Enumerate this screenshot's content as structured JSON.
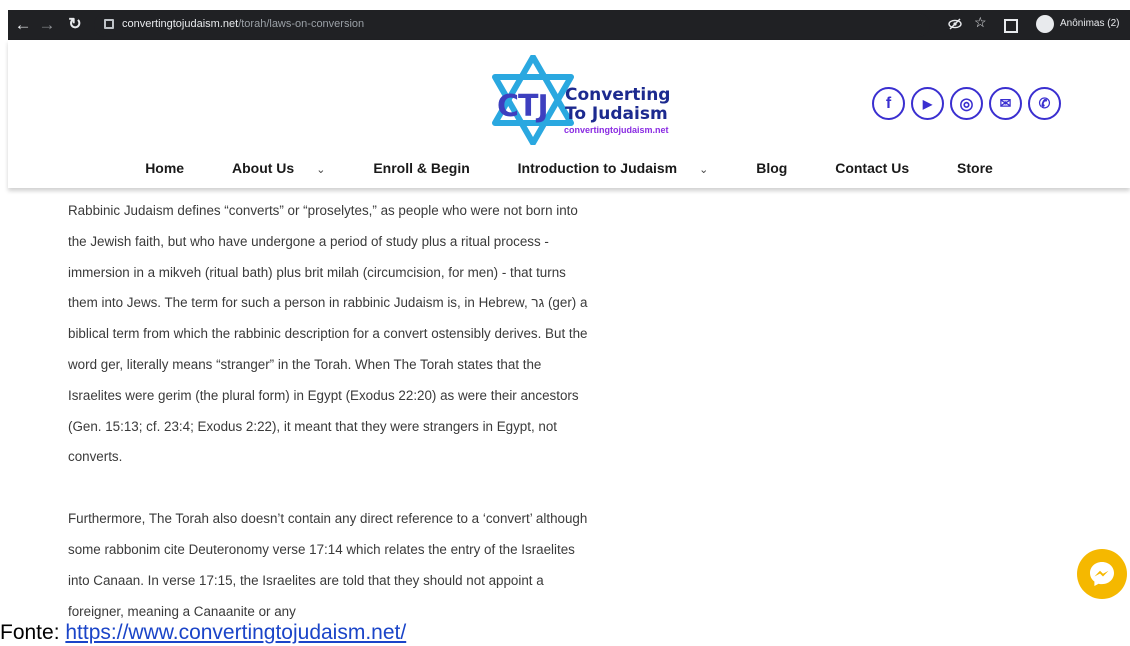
{
  "browser": {
    "url_domain": "convertingtojudaism.net",
    "url_path": "/torah/laws-on-conversion",
    "profile_label": "Anônimas (2)"
  },
  "site": {
    "logo": {
      "mark": "CTJ",
      "line1": "Converting",
      "line2": "To Judaism",
      "subtitle": "convertingtojudaism.net"
    },
    "socials": [
      {
        "icon": "facebook-icon",
        "glyph": "f"
      },
      {
        "icon": "youtube-icon",
        "glyph": "▶"
      },
      {
        "icon": "instagram-icon",
        "glyph": "◎"
      },
      {
        "icon": "email-icon",
        "glyph": "✉"
      },
      {
        "icon": "whatsapp-icon",
        "glyph": "✆"
      }
    ],
    "nav": [
      {
        "label": "Home",
        "dropdown": false
      },
      {
        "label": "About Us",
        "dropdown": true
      },
      {
        "label": "Enroll & Begin",
        "dropdown": false
      },
      {
        "label": "Introduction to Judaism",
        "dropdown": true
      },
      {
        "label": "Blog",
        "dropdown": false
      },
      {
        "label": "Contact Us",
        "dropdown": false
      },
      {
        "label": "Store",
        "dropdown": false
      }
    ]
  },
  "article": {
    "paragraph1": "Rabbinic Judaism defines “converts” or “proselytes,” as people who were not born into the Jewish faith, but who have undergone a period of study plus a ritual process - immersion in a mikveh (ritual bath) plus brit milah (circumcision, for men) - that turns them into Jews. The term for such a person in rabbinic Judaism is, in Hebrew, גר (ger) a biblical term from which the rabbinic description for a convert ostensibly derives. But the word ger, literally means “stranger” in the Torah. When The Torah states that the Israelites were gerim (the plural form) in Egypt (Exodus 22:20) as were their ancestors (Gen. 15:13; cf. 23:4; Exodus 2:22),  it meant that they were strangers in Egypt, not converts.",
    "paragraph2": "Furthermore, The Torah also doesn’t contain any direct reference to a ‘convert’ although some rabbonim cite Deuteronomy verse 17:14 which relates the entry of the Israelites into Canaan. In verse 17:15, the Israelites are told that they should not appoint a foreigner, meaning a Canaanite or any"
  },
  "caption": {
    "prefix": "Fonte: ",
    "link": "https://www.convertingtojudaism.net/"
  },
  "colors": {
    "brand_blue": "#3a2fd0",
    "messenger": "#f5b800",
    "chrome_bg": "#202124"
  }
}
